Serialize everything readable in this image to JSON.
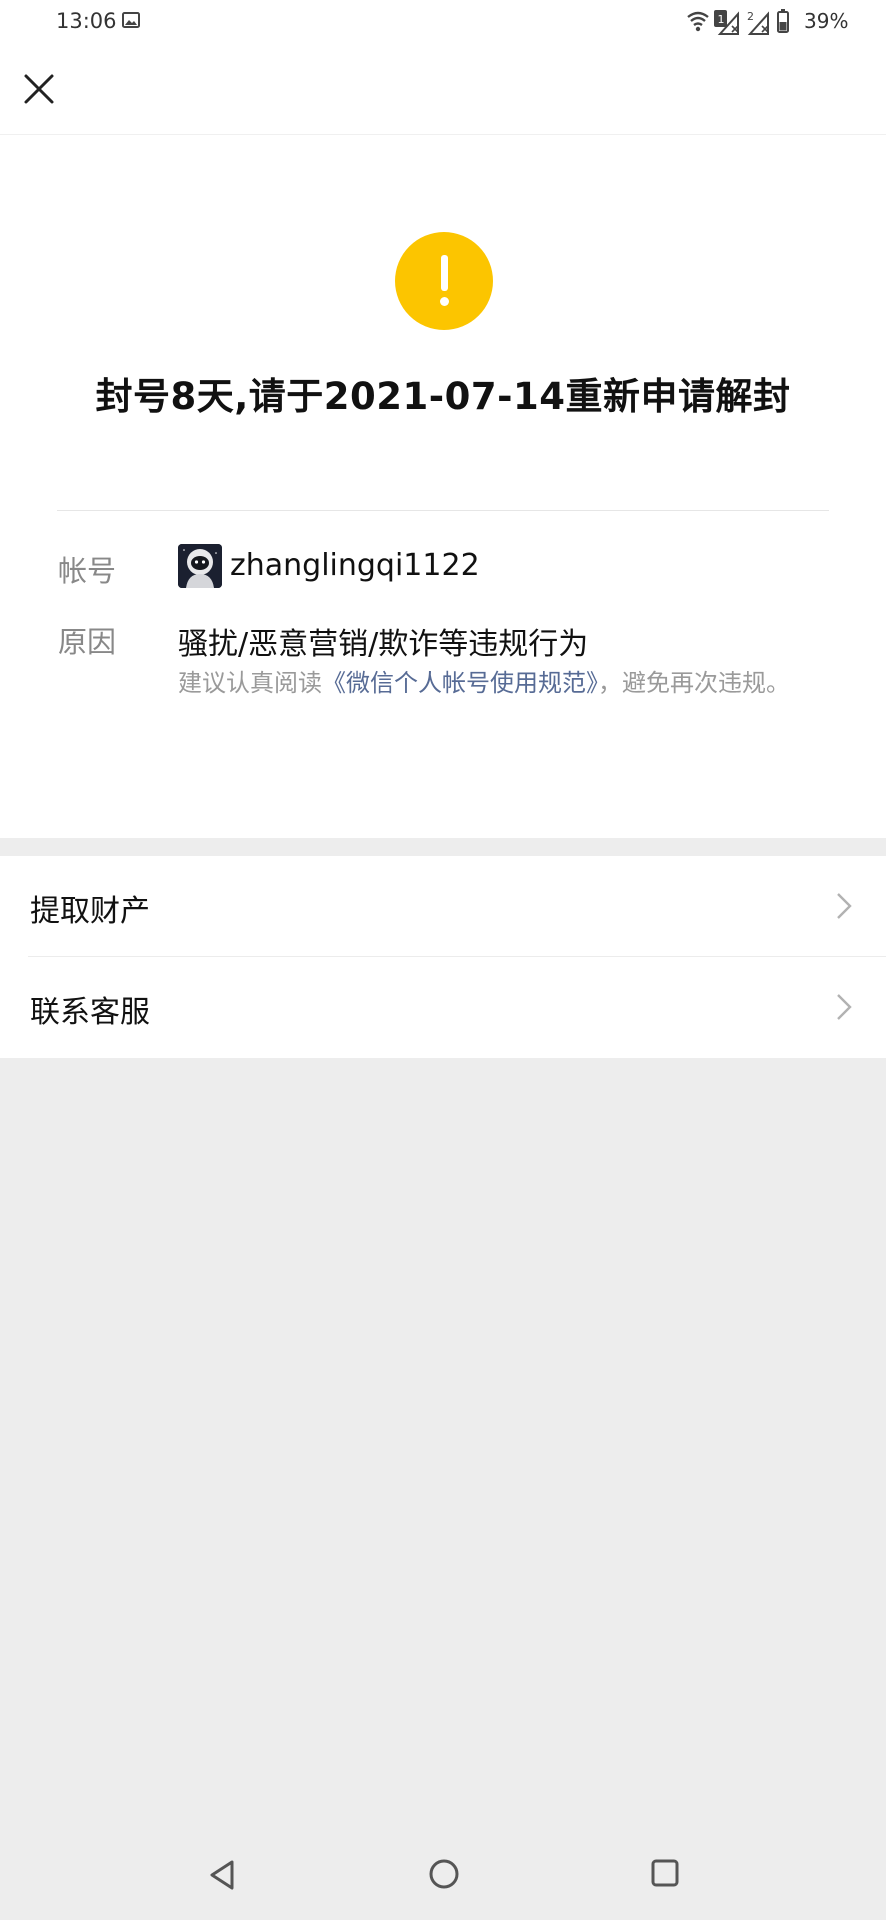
{
  "status_bar": {
    "time": "13:06",
    "battery": "39%",
    "icons": [
      "gallery-icon",
      "wifi-icon",
      "sim1-icon",
      "signal-icon",
      "sim2-icon",
      "signal2-icon",
      "battery-icon"
    ]
  },
  "header": {
    "close_icon": "close-icon"
  },
  "warning": {
    "icon": "exclamation-icon",
    "color": "#fcc500",
    "title": "封号8天,请于2021-07-14重新申请解封"
  },
  "details": {
    "account_label": "帐号",
    "account_name": "zhanglingqi1122",
    "reason_label": "原因",
    "reason_text": "骚扰/恶意营销/欺诈等违规行为",
    "note_prefix": "建议认真阅读",
    "note_link": "《微信个人帐号使用规范》",
    "note_suffix": "，避免再次违规。",
    "link_color": "#576b95"
  },
  "list": {
    "items": [
      {
        "label": "提取财产",
        "icon": "chevron-right-icon"
      },
      {
        "label": "联系客服",
        "icon": "chevron-right-icon"
      }
    ]
  },
  "bottom_nav": {
    "icons": [
      "back-icon",
      "home-icon",
      "recents-icon"
    ]
  }
}
